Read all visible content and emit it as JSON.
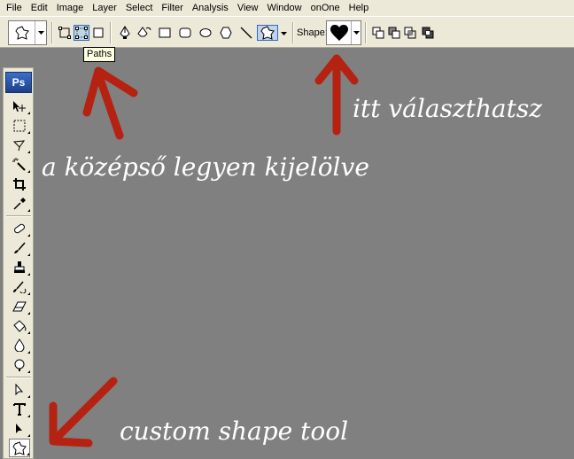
{
  "menubar": {
    "items": [
      "File",
      "Edit",
      "Image",
      "Layer",
      "Select",
      "Filter",
      "Analysis",
      "View",
      "Window",
      "onOne",
      "Help"
    ]
  },
  "options_bar": {
    "shape_label": "Shape:",
    "tooltip": "Paths"
  },
  "toolbox": {
    "logo": "Ps"
  },
  "annotations": {
    "middle_selected": "a középső legyen kijelölve",
    "choose_here": "itt választhatsz",
    "custom_shape_tool": "custom shape tool"
  },
  "colors": {
    "arrow": "#b52211",
    "canvas": "#808080",
    "chrome": "#ece9d8"
  }
}
